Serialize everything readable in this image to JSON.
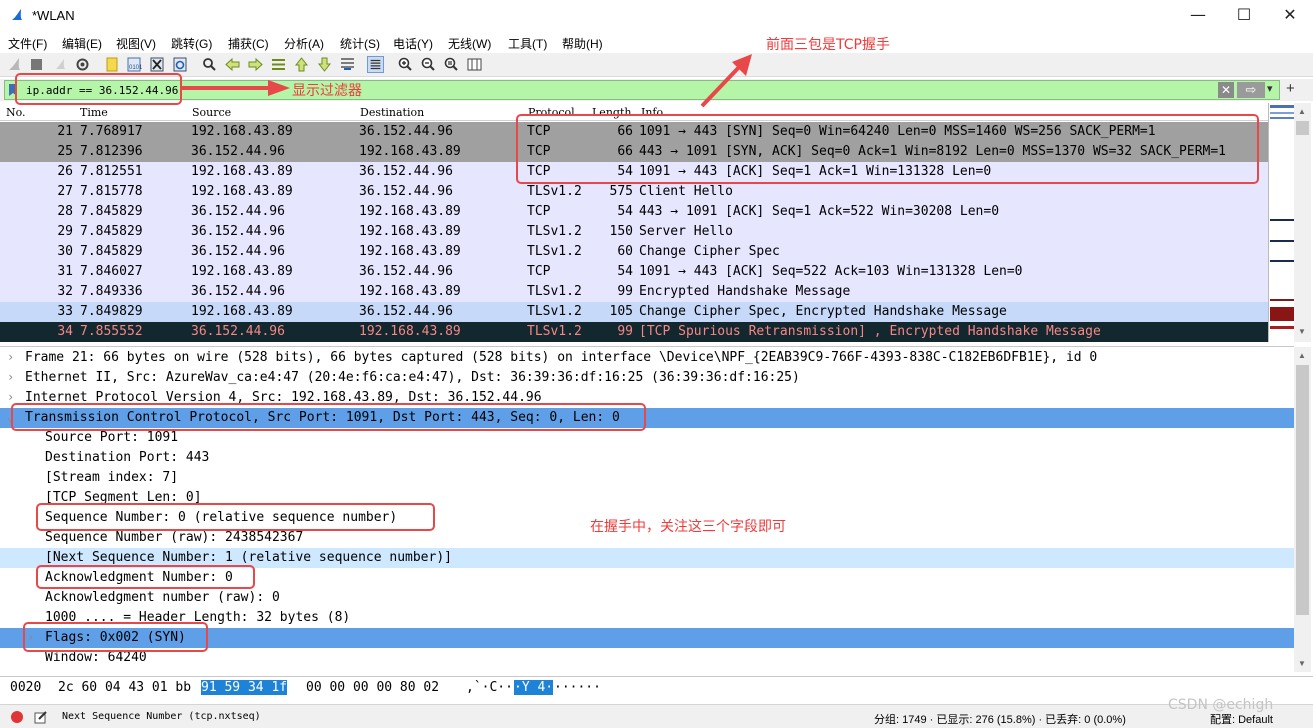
{
  "window": {
    "title": "*WLAN",
    "minimize": "—",
    "maximize": "☐",
    "close": "✕"
  },
  "menu": [
    "文件(F)",
    "编辑(E)",
    "视图(V)",
    "跳转(G)",
    "捕获(C)",
    "分析(A)",
    "统计(S)",
    "电话(Y)",
    "无线(W)",
    "工具(T)",
    "帮助(H)"
  ],
  "toolbar": {
    "icons": [
      "shark-fin-start-icon",
      "stop-icon",
      "restart-icon",
      "options-icon",
      "open-icon",
      "save-icon",
      "close-file-icon",
      "reload-icon",
      "find-icon",
      "back-icon",
      "forward-icon",
      "goto-icon",
      "first-icon",
      "last-icon",
      "autoscroll-icon",
      "colorize-icon",
      "zoom-in-icon",
      "zoom-out-icon",
      "zoom-reset-icon",
      "resize-columns-icon"
    ]
  },
  "filter": {
    "value": "ip.addr == 36.152.44.96",
    "apply_arrow": "⇨",
    "dropdown": "▾",
    "add": "+"
  },
  "packet_list": {
    "columns": [
      "No.",
      "Time",
      "Source",
      "Destination",
      "Protocol",
      "Length",
      "Info"
    ],
    "rows": [
      {
        "no": "21",
        "time": "7.768917",
        "src": "192.168.43.89",
        "dst": "36.152.44.96",
        "proto": "TCP",
        "len": "66",
        "info": "1091 → 443 [SYN] Seq=0 Win=64240 Len=0 MSS=1460 WS=256 SACK_PERM=1",
        "style": "sel-g"
      },
      {
        "no": "25",
        "time": "7.812396",
        "src": "36.152.44.96",
        "dst": "192.168.43.89",
        "proto": "TCP",
        "len": "66",
        "info": "443 → 1091 [SYN, ACK] Seq=0 Ack=1 Win=8192 Len=0 MSS=1370 WS=32 SACK_PERM=1",
        "style": "sel-g"
      },
      {
        "no": "26",
        "time": "7.812551",
        "src": "192.168.43.89",
        "dst": "36.152.44.96",
        "proto": "TCP",
        "len": "54",
        "info": "1091 → 443 [ACK] Seq=1 Ack=1 Win=131328 Len=0",
        "style": ""
      },
      {
        "no": "27",
        "time": "7.815778",
        "src": "192.168.43.89",
        "dst": "36.152.44.96",
        "proto": "TLSv1.2",
        "len": "575",
        "info": "Client Hello",
        "style": ""
      },
      {
        "no": "28",
        "time": "7.845829",
        "src": "36.152.44.96",
        "dst": "192.168.43.89",
        "proto": "TCP",
        "len": "54",
        "info": "443 → 1091 [ACK] Seq=1 Ack=522 Win=30208 Len=0",
        "style": ""
      },
      {
        "no": "29",
        "time": "7.845829",
        "src": "36.152.44.96",
        "dst": "192.168.43.89",
        "proto": "TLSv1.2",
        "len": "150",
        "info": "Server Hello",
        "style": ""
      },
      {
        "no": "30",
        "time": "7.845829",
        "src": "36.152.44.96",
        "dst": "192.168.43.89",
        "proto": "TLSv1.2",
        "len": "60",
        "info": "Change Cipher Spec",
        "style": ""
      },
      {
        "no": "31",
        "time": "7.846027",
        "src": "192.168.43.89",
        "dst": "36.152.44.96",
        "proto": "TCP",
        "len": "54",
        "info": "1091 → 443 [ACK] Seq=522 Ack=103 Win=131328 Len=0",
        "style": ""
      },
      {
        "no": "32",
        "time": "7.849336",
        "src": "36.152.44.96",
        "dst": "192.168.43.89",
        "proto": "TLSv1.2",
        "len": "99",
        "info": "Encrypted Handshake Message",
        "style": ""
      },
      {
        "no": "33",
        "time": "7.849829",
        "src": "192.168.43.89",
        "dst": "36.152.44.96",
        "proto": "TLSv1.2",
        "len": "105",
        "info": "Change Cipher Spec, Encrypted Handshake Message",
        "style": "blue"
      },
      {
        "no": "34",
        "time": "7.855552",
        "src": "36.152.44.96",
        "dst": "192.168.43.89",
        "proto": "TLSv1.2",
        "len": "99",
        "info": "[TCP Spurious Retransmission] , Encrypted Handshake Message",
        "style": "dark"
      }
    ]
  },
  "details": [
    {
      "arrow": "›",
      "indent": 0,
      "text": "Frame 21: 66 bytes on wire (528 bits), 66 bytes captured (528 bits) on interface \\Device\\NPF_{2EAB39C9-766F-4393-838C-C182EB6DFB1E}, id 0",
      "style": ""
    },
    {
      "arrow": "›",
      "indent": 0,
      "text": "Ethernet II, Src: AzureWav_ca:e4:47 (20:4e:f6:ca:e4:47), Dst: 36:39:36:df:16:25 (36:39:36:df:16:25)",
      "style": ""
    },
    {
      "arrow": "›",
      "indent": 0,
      "text": "Internet Protocol Version 4, Src: 192.168.43.89, Dst: 36.152.44.96",
      "style": ""
    },
    {
      "arrow": "⌄",
      "indent": 0,
      "text": "Transmission Control Protocol, Src Port: 1091, Dst Port: 443, Seq: 0, Len: 0",
      "style": "hl"
    },
    {
      "arrow": "",
      "indent": 1,
      "text": "Source Port: 1091",
      "style": ""
    },
    {
      "arrow": "",
      "indent": 1,
      "text": "Destination Port: 443",
      "style": ""
    },
    {
      "arrow": "",
      "indent": 1,
      "text": "[Stream index: 7]",
      "style": ""
    },
    {
      "arrow": "",
      "indent": 1,
      "text": "[TCP Segment Len: 0]",
      "style": ""
    },
    {
      "arrow": "",
      "indent": 1,
      "text": "Sequence Number: 0    (relative sequence number)",
      "style": ""
    },
    {
      "arrow": "",
      "indent": 1,
      "text": "Sequence Number (raw): 2438542367",
      "style": ""
    },
    {
      "arrow": "",
      "indent": 1,
      "text": "[Next Sequence Number: 1    (relative sequence number)]",
      "style": "hl2"
    },
    {
      "arrow": "",
      "indent": 1,
      "text": "Acknowledgment Number: 0",
      "style": ""
    },
    {
      "arrow": "",
      "indent": 1,
      "text": "Acknowledgment number (raw): 0",
      "style": ""
    },
    {
      "arrow": "",
      "indent": 1,
      "text": "1000 .... = Header Length: 32 bytes (8)",
      "style": ""
    },
    {
      "arrow": "›",
      "indent": 1,
      "text": "Flags: 0x002 (SYN)",
      "style": "hl"
    },
    {
      "arrow": "",
      "indent": 1,
      "text": "Window: 64240",
      "style": ""
    }
  ],
  "bytes": {
    "offset": "0020",
    "hex_a": "2c 60 04 43 01 bb",
    "hex_sel": "91 59  34 1f",
    "hex_b": "00 00 00 00 80 02",
    "ascii_a": ",`·C··",
    "ascii_sel": "·Y 4·",
    "ascii_b": "······"
  },
  "status": {
    "field": "Next Sequence Number (tcp.nxtseq)",
    "packets": "分组: 1749 · 已显示: 276 (15.8%) · 已丢弃: 0 (0.0%)",
    "profile": "配置: Default"
  },
  "annotations": {
    "handshake": "前面三包是TCP握手",
    "filter": "显示过滤器",
    "fields": "在握手中，关注这三个字段即可"
  },
  "watermark": "CSDN @echigh",
  "colors": {
    "filter_bg": "#b4f5a7",
    "row_bg": "#e7e6ff",
    "row_selected_gray": "#a0a0a0",
    "row_dark_bg": "#12272e",
    "row_dark_fg": "#f78787",
    "detail_highlight": "#5f9fe8",
    "annotation_red": "#e8484a"
  }
}
